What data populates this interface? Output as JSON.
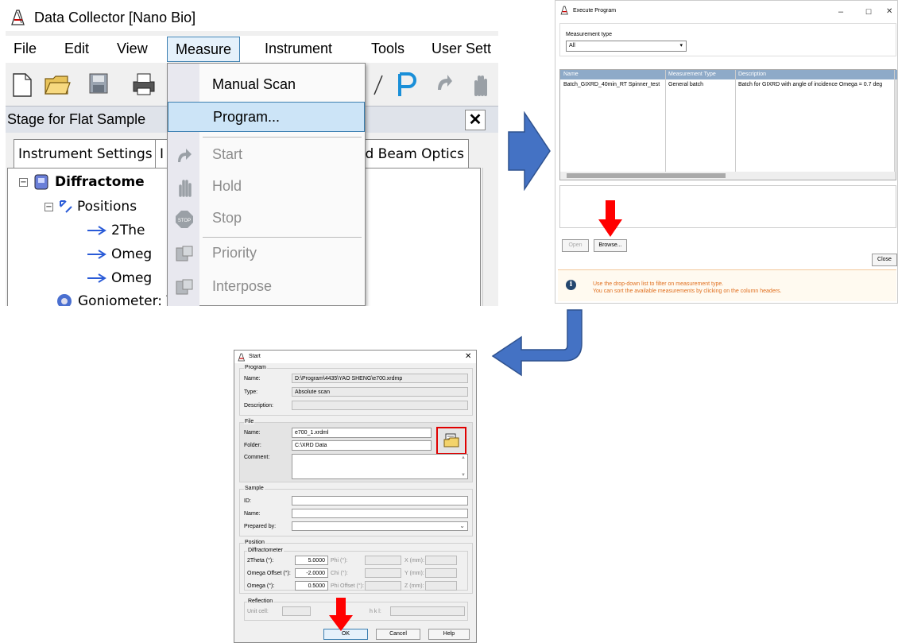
{
  "colors": {
    "accent": "#4472c4",
    "red": "#ff0000",
    "info_text": "#e07020",
    "menu_highlight": "#cce4f7",
    "table_header": "#8eaac8"
  },
  "data_collector": {
    "title": "Data Collector [Nano Bio]",
    "menu": [
      "File",
      "Edit",
      "View",
      "Measure",
      "Instrument",
      "Tools",
      "User Sett"
    ],
    "stage_label": "Stage for Flat Sample",
    "tabs": [
      "Instrument Settings",
      "I",
      "cted Beam Optics"
    ],
    "tree": [
      {
        "label": "Diffractome",
        "bold": true,
        "icon": "diffractometer-icon"
      },
      {
        "label": "Positions",
        "bold": false,
        "icon": "positions-icon"
      },
      {
        "label": "2The",
        "bold": false,
        "icon": "axis-arrow-icon"
      },
      {
        "label": "Omeg",
        "bold": false,
        "icon": "axis-arrow-icon"
      },
      {
        "label": "Omeg",
        "bold": false,
        "icon": "axis-arrow-icon"
      },
      {
        "label": "Goniometer: Theta/Theta",
        "bold": false,
        "icon": "goniometer-icon"
      }
    ],
    "measure_menu": [
      {
        "label": "Manual Scan",
        "enabled": true,
        "highlighted": false
      },
      {
        "label": "Program...",
        "enabled": true,
        "highlighted": true
      },
      {
        "label": "Start",
        "enabled": false,
        "highlighted": false
      },
      {
        "label": "Hold",
        "enabled": false,
        "highlighted": false
      },
      {
        "label": "Stop",
        "enabled": false,
        "highlighted": false
      },
      {
        "label": "Priority",
        "enabled": false,
        "highlighted": false
      },
      {
        "label": "Interpose",
        "enabled": false,
        "highlighted": false
      }
    ]
  },
  "execute_program": {
    "title": "Execute Program",
    "measurement_type_label": "Measurement type",
    "measurement_type_value": "All",
    "columns": [
      "Name",
      "Measurement Type",
      "Description"
    ],
    "rows": [
      [
        "Batch_GIXRD_40min_RT Spinner_test",
        "General batch",
        "Batch for GIXRD with angle of incidence Omega = 0.7 deg"
      ]
    ],
    "open_label": "Open",
    "browse_label": "Browse...",
    "close_label": "Close",
    "info_lines": [
      "Use the drop-down list to filter on measurement type.",
      "You can sort the available measurements by clicking on the column headers."
    ]
  },
  "start_dialog": {
    "title": "Start",
    "program_group": "Program",
    "program_name_label": "Name:",
    "program_name": "D:\\Program\\4435\\YAO SHENG\\e700.xrdmp",
    "type_label": "Type:",
    "type_value": "Absolute scan",
    "description_label": "Description:",
    "file_group": "File",
    "file_name_label": "Name:",
    "file_name": "e700_1.xrdml",
    "folder_label": "Folder:",
    "folder_value": "C:\\XRD Data",
    "comment_label": "Comment:",
    "sample_group": "Sample",
    "id_label": "ID:",
    "sample_name_label": "Name:",
    "prepared_by_label": "Prepared by:",
    "position_group": "Position",
    "diffractometer_group": "Diffractometer",
    "twotheta_label": "2Theta (°):",
    "twotheta_value": "5.0000",
    "omega_offset_label": "Omega Offset (°):",
    "omega_offset_value": "-2.0000",
    "omega_label": "Omega (°):",
    "omega_value": "0.5000",
    "phi_label": "Phi (°):",
    "chi_label": "Chi (°):",
    "phi_offset_label": "Phi Offset (°):",
    "x_label": "X (mm):",
    "y_label": "Y (mm):",
    "z_label": "Z (mm):",
    "reflection_group": "Reflection",
    "unit_cell_label": "Unit cell:",
    "hkl_label": "h k l:",
    "ok_label": "OK",
    "cancel_label": "Cancel",
    "help_label": "Help"
  }
}
